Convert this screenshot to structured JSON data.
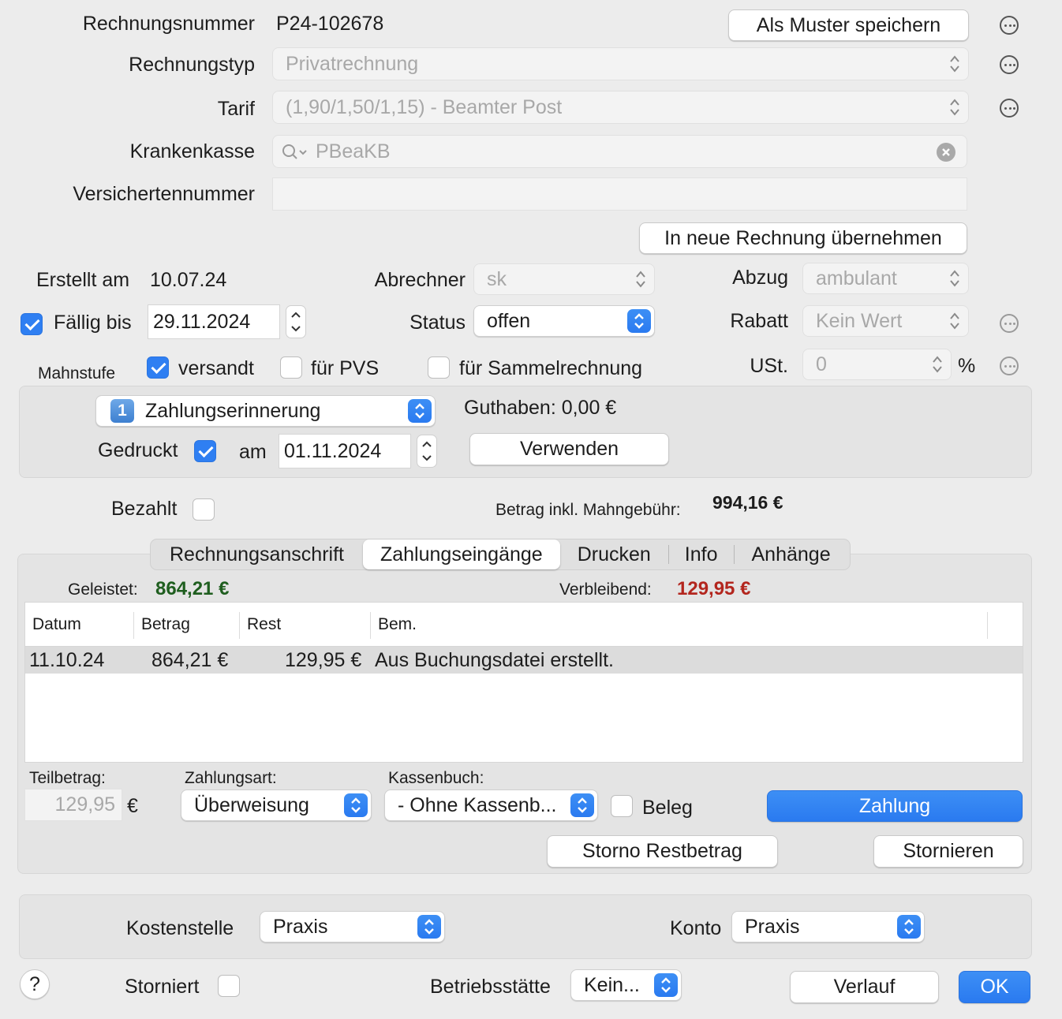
{
  "header": {
    "rechnungsnummer_label": "Rechnungsnummer",
    "rechnungsnummer_value": "P24-102678",
    "muster_button": "Als Muster speichern",
    "rechnungstyp_label": "Rechnungstyp",
    "rechnungstyp_value": "Privatrechnung",
    "tarif_label": "Tarif",
    "tarif_value": "(1,90/1,50/1,15) - Beamter Post",
    "krankenkasse_label": "Krankenkasse",
    "krankenkasse_value": "PBeaKB",
    "versichertennummer_label": "Versichertennummer",
    "versichertennummer_value": "",
    "uebernehmen_button": "In neue Rechnung übernehmen"
  },
  "meta": {
    "erstellt_label": "Erstellt am",
    "erstellt_value": "10.07.24",
    "abrechner_label": "Abrechner",
    "abrechner_value": "sk",
    "abzug_label": "Abzug",
    "abzug_value": "ambulant",
    "faellig_label": "Fällig bis",
    "faellig_value": "29.11.2024",
    "faellig_checked": true,
    "status_label": "Status",
    "status_value": "offen",
    "rabatt_label": "Rabatt",
    "rabatt_value": "Kein Wert",
    "mahnstufe_label": "Mahnstufe",
    "versandt_label": "versandt",
    "versandt_checked": true,
    "pvs_label": "für PVS",
    "pvs_checked": false,
    "sammel_label": "für Sammelrechnung",
    "sammel_checked": false,
    "ust_label": "USt.",
    "ust_value": "0",
    "ust_unit": "%"
  },
  "mahnung": {
    "stufe_icon": "1",
    "stufe_value": "Zahlungserinnerung",
    "guthaben": "Guthaben: 0,00 €",
    "gedruckt_label": "Gedruckt",
    "gedruckt_checked": true,
    "am_label": "am",
    "am_value": "01.11.2024",
    "verwenden_button": "Verwenden"
  },
  "payment_summary": {
    "bezahlt_label": "Bezahlt",
    "bezahlt_checked": false,
    "betrag_label": "Betrag inkl. Mahngebühr:",
    "betrag_value": "994,16 €"
  },
  "tabs": [
    {
      "label": "Rechnungsanschrift",
      "selected": false
    },
    {
      "label": "Zahlungseingänge",
      "selected": true
    },
    {
      "label": "Drucken",
      "selected": false
    },
    {
      "label": "Info",
      "selected": false
    },
    {
      "label": "Anhänge",
      "selected": false
    }
  ],
  "zahlungen": {
    "geleistet_label": "Geleistet:",
    "geleistet_value": "864,21 €",
    "verbleibend_label": "Verbleibend:",
    "verbleibend_value": "129,95 €",
    "columns": [
      "Datum",
      "Betrag",
      "Rest",
      "Bem."
    ],
    "rows": [
      {
        "datum": "11.10.24",
        "betrag": "864,21 €",
        "rest": "129,95 €",
        "bem": "Aus Buchungsdatei erstellt."
      }
    ],
    "teilbetrag_label": "Teilbetrag:",
    "teilbetrag_value": "129,95",
    "teilbetrag_unit": "€",
    "zahlungsart_label": "Zahlungsart:",
    "zahlungsart_value": "Überweisung",
    "kassenbuch_label": "Kassenbuch:",
    "kassenbuch_value": "- Ohne Kassenb...",
    "beleg_label": "Beleg",
    "beleg_checked": false,
    "zahlung_button": "Zahlung",
    "storno_rest_button": "Storno Restbetrag",
    "stornieren_button": "Stornieren"
  },
  "footer": {
    "kostenstelle_label": "Kostenstelle",
    "kostenstelle_value": "Praxis",
    "konto_label": "Konto",
    "konto_value": "Praxis",
    "help_label": "?",
    "storniert_label": "Storniert",
    "storniert_checked": false,
    "betriebsstaette_label": "Betriebsstätte",
    "betriebsstaette_value": "Kein...",
    "verlauf_button": "Verlauf",
    "ok_button": "OK"
  },
  "colors": {
    "accent": "#2f7ff2",
    "geleistet": "#1f5e1f",
    "verbleibend": "#b3261e"
  }
}
